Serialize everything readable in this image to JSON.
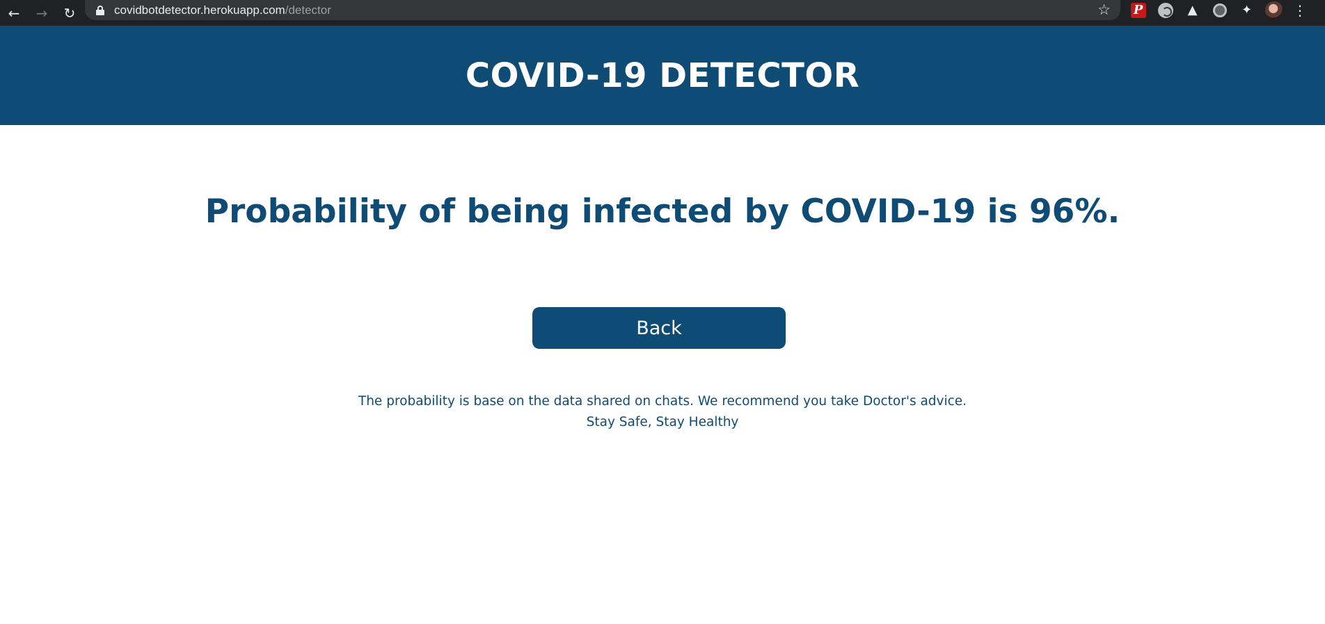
{
  "browser": {
    "url_host": "covidbotdetector.herokuapp.com",
    "url_path": "/detector",
    "icons": [
      "back-arrow-icon",
      "forward-arrow-icon",
      "reload-icon",
      "lock-icon",
      "star-icon",
      "extension-p-icon",
      "extension-circle-icon",
      "extension-spy-icon",
      "extension-ring-icon",
      "extensions-puzzle-icon",
      "profile-avatar",
      "menu-dots-icon"
    ]
  },
  "header": {
    "title": "COVID-19 DETECTOR"
  },
  "main": {
    "result_text": "Probability of being infected by COVID-19 is 96%.",
    "back_label": "Back",
    "disclaimer_line1": "The probability is base on the data shared on chats. We recommend you take Doctor's advice.",
    "disclaimer_line2": "Stay Safe, Stay Healthy"
  },
  "colors": {
    "primary": "#0f4c75",
    "browser_bar": "#202124",
    "omnibox": "#35363a",
    "background": "#ffffff"
  }
}
